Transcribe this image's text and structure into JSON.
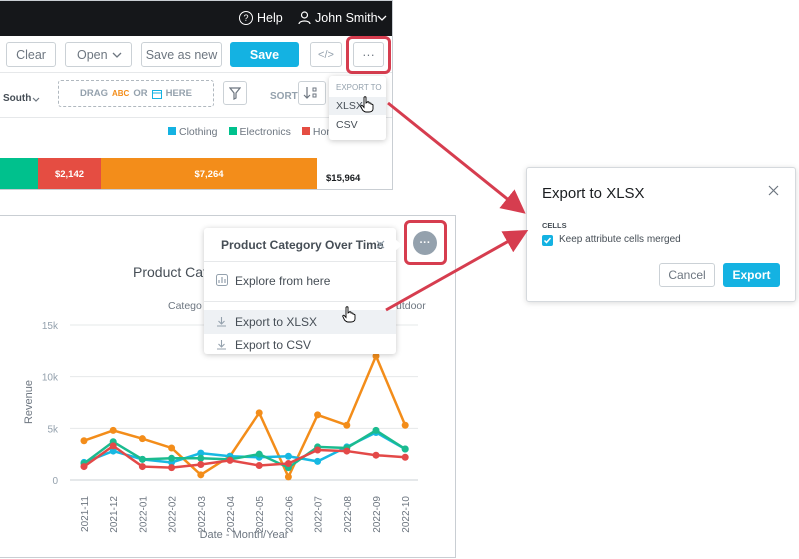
{
  "panel_top": {
    "topbar": {
      "help_label": "Help",
      "user_name": "John Smith"
    },
    "toolbar": {
      "clear_label": "Clear",
      "open_label": "Open",
      "save_as_new_label": "Save as new",
      "save_label": "Save",
      "embed_label": "</>",
      "more_label": "···"
    },
    "bucket": {
      "filter_value": "South",
      "drag_text": "DRAG",
      "abc_text": "ABC",
      "or_text": "OR",
      "here_text": "HERE",
      "sort_label": "SORT"
    },
    "export_menu": {
      "header": "EXPORT TO",
      "items": [
        "XLSX",
        "CSV"
      ]
    },
    "legend": [
      "Clothing",
      "Electronics",
      "Home"
    ],
    "bar": {
      "segments": [
        "$2,142",
        "$7,264"
      ],
      "total": "$15,964"
    }
  },
  "panel_chart": {
    "menu": {
      "title": "Product Category Over Time",
      "items": [
        "Explore from here",
        "Export to XLSX",
        "Export to CSV"
      ]
    },
    "more_label": "···",
    "partial_title": "Product Cat",
    "partial_legend_left": "Catego",
    "partial_legend_right": "utdoor"
  },
  "dialog": {
    "title": "Export to XLSX",
    "section_label": "CELLS",
    "checkbox_label": "Keep attribute cells merged",
    "checkbox_checked": true,
    "cancel_label": "Cancel",
    "export_label": "Export"
  },
  "chart_data": {
    "type": "line",
    "xlabel": "Date - Month/Year",
    "ylabel": "Revenue",
    "ylim": [
      0,
      15000
    ],
    "yticks": [
      "0",
      "5k",
      "10k",
      "15k"
    ],
    "categories": [
      "2021-11",
      "2021-12",
      "2022-01",
      "2022-02",
      "2022-03",
      "2022-04",
      "2022-05",
      "2022-06",
      "2022-07",
      "2022-08",
      "2022-09",
      "2022-10"
    ],
    "series": [
      {
        "color": "#f38d1a",
        "values": [
          3800,
          4800,
          4000,
          3100,
          500,
          2300,
          6500,
          300,
          6300,
          5300,
          12000,
          5300
        ]
      },
      {
        "color": "#17b8e2",
        "values": [
          1700,
          2800,
          2000,
          1700,
          2600,
          2300,
          2200,
          2300,
          1800,
          3200,
          4600,
          3000
        ]
      },
      {
        "color": "#1bbb8f",
        "values": [
          1600,
          3700,
          2000,
          2100,
          2100,
          2000,
          2500,
          1200,
          3200,
          3100,
          4800,
          3000
        ]
      },
      {
        "color": "#e34948",
        "values": [
          1300,
          3300,
          1300,
          1200,
          1500,
          1900,
          1400,
          1600,
          2900,
          2800,
          2400,
          2200
        ]
      }
    ],
    "legend_colors": {
      "clothing": "#14b2e2",
      "electronics": "#00c18d",
      "home": "#e54d42"
    }
  }
}
